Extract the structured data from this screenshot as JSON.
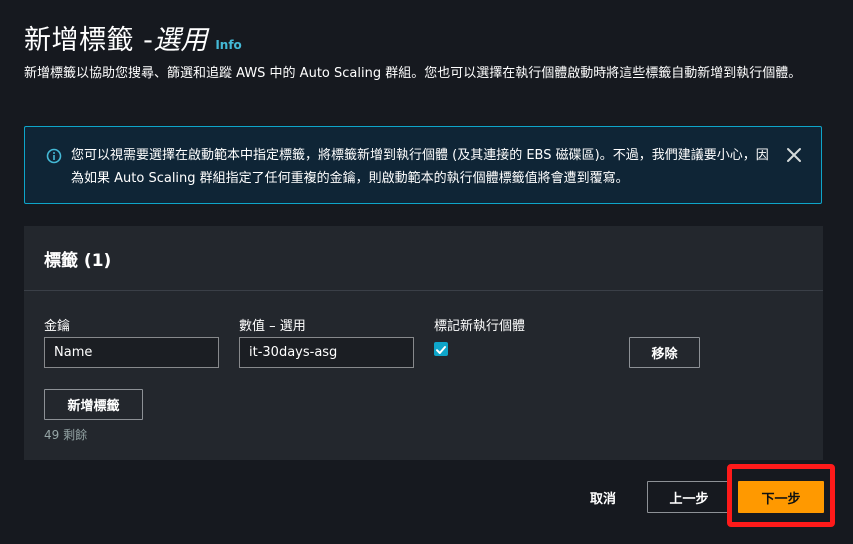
{
  "header": {
    "title": "新增標籤 - ",
    "title_optional": "選用",
    "info_link": "Info"
  },
  "description": "新增標籤以協助您搜尋、篩選和追蹤 AWS 中的 Auto Scaling 群組。您也可以選擇在執行個體啟動時將這些標籤自動新增到執行個體。",
  "alert": {
    "text": "您可以視需要選擇在啟動範本中指定標籤，將標籤新增到執行個體 (及其連接的 EBS 磁碟區)。不過，我們建議要小心，因為如果 Auto Scaling 群組指定了任何重複的金鑰，則啟動範本的執行個體標籤值將會遭到覆寫。",
    "info_icon": "info-circle-icon",
    "close_icon": "close-icon"
  },
  "tags_panel": {
    "title": "標籤 (1)",
    "columns": {
      "key_label": "金鑰",
      "value_label": "數值 – 選用",
      "propagate_label": "標記新執行個體"
    },
    "rows": [
      {
        "key": "Name",
        "value": "it-30days-asg",
        "propagate": true,
        "remove_label": "移除"
      }
    ],
    "add_tag_label": "新增標籤",
    "remaining": "49 剩餘"
  },
  "footer": {
    "cancel_label": "取消",
    "previous_label": "上一步",
    "next_label": "下一步"
  },
  "colors": {
    "background": "#16191f",
    "panel": "#23272d",
    "accent": "#ff9900",
    "link": "#44b9d6",
    "alert_border": "#0ea5c9",
    "highlight": "#ff1a1a"
  }
}
